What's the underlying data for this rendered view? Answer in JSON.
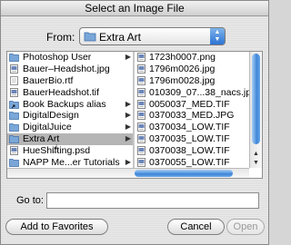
{
  "dialog": {
    "title": "Select an Image File"
  },
  "from": {
    "label": "From:",
    "selected": "Extra Art"
  },
  "browser": {
    "column1": [
      {
        "name": "Photoshop User",
        "icon": "folder-icon",
        "folder": true
      },
      {
        "name": "Bauer–Headshot.jpg",
        "icon": "image-file-icon",
        "folder": false
      },
      {
        "name": "BauerBio.rtf",
        "icon": "document-icon",
        "folder": false
      },
      {
        "name": "BauerHeadshot.tif",
        "icon": "image-file-icon",
        "folder": false
      },
      {
        "name": "Book Backups alias",
        "icon": "folder-alias-icon",
        "folder": true
      },
      {
        "name": "DigitalDesign",
        "icon": "folder-icon",
        "folder": true
      },
      {
        "name": "DigitalJuice",
        "icon": "folder-icon",
        "folder": true
      },
      {
        "name": "Extra Art",
        "icon": "folder-icon",
        "folder": true,
        "selected": true
      },
      {
        "name": "HueShifting.psd",
        "icon": "image-file-icon",
        "folder": false
      },
      {
        "name": "NAPP Me...er Tutorials",
        "icon": "folder-icon",
        "folder": true
      }
    ],
    "column2": [
      {
        "name": "1723h0007.png",
        "icon": "image-file-icon"
      },
      {
        "name": "1796m0026.jpg",
        "icon": "image-file-icon"
      },
      {
        "name": "1796m0028.jpg",
        "icon": "image-file-icon"
      },
      {
        "name": "010309_07...38_nacs.jpg",
        "icon": "image-file-icon"
      },
      {
        "name": "0050037_MED.TIF",
        "icon": "image-file-icon"
      },
      {
        "name": "0370033_MED.JPG",
        "icon": "image-file-icon"
      },
      {
        "name": "0370034_LOW.TIF",
        "icon": "image-file-icon"
      },
      {
        "name": "0370035_LOW.TIF",
        "icon": "image-file-icon"
      },
      {
        "name": "0370038_LOW.TIF",
        "icon": "image-file-icon"
      },
      {
        "name": "0370055_LOW.TIF",
        "icon": "image-file-icon"
      }
    ]
  },
  "goto": {
    "label": "Go to:",
    "value": ""
  },
  "buttons": {
    "add_favorites": "Add to Favorites",
    "cancel": "Cancel",
    "open": "Open"
  },
  "colors": {
    "accent": "#3f86d8",
    "selection": "#b5b5b5"
  }
}
